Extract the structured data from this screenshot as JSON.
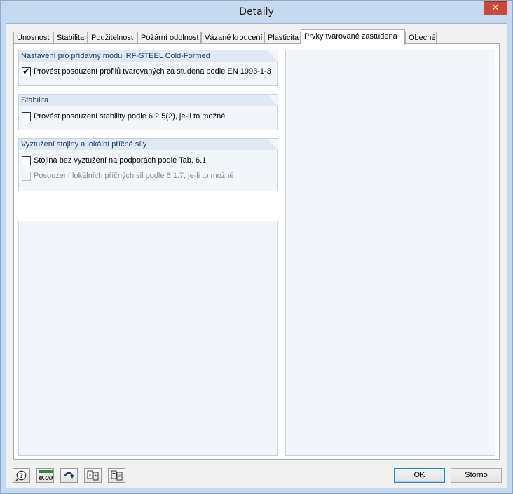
{
  "window": {
    "title": "Detaily",
    "close_glyph": "✕"
  },
  "tabs": [
    {
      "label": "Únosnost",
      "active": false
    },
    {
      "label": "Stabilita",
      "active": false
    },
    {
      "label": "Použitelnost",
      "active": false
    },
    {
      "label": "Požární odolnost",
      "active": false
    },
    {
      "label": "Vázané kroucení",
      "active": false
    },
    {
      "label": "Plasticita",
      "active": false
    },
    {
      "label": "Prvky tvarované zastudena",
      "active": true
    },
    {
      "label": "Obecné",
      "active": false
    }
  ],
  "groups": {
    "cold_formed": {
      "title": "Nastavení pro přídavný modul RF-STEEL Cold-Formed",
      "options": [
        {
          "label": "Provést posouzení profilů tvarovaných za studena podle EN 1993-1-3",
          "checked": true,
          "enabled": true
        }
      ]
    },
    "stability": {
      "title": "Stabilita",
      "options": [
        {
          "label": "Provést posouzení stability podle 6.2.5(2), je-li to možné",
          "checked": false,
          "enabled": true
        }
      ]
    },
    "web": {
      "title": "Vyztužení stojiny a lokální příčné síly",
      "options": [
        {
          "label": "Stojina bez vyztužení na podporách podle Tab. 6.1",
          "checked": false,
          "enabled": true
        },
        {
          "label": "Posouzení lokálních příčných sil podle 6.1.7, je-li to možné",
          "checked": false,
          "enabled": false
        }
      ]
    }
  },
  "toolbar_icons": [
    "help-icon",
    "units-icon",
    "reset-icon",
    "load-icon",
    "save-icon"
  ],
  "units_icon_text": "0.00",
  "buttons": {
    "ok": "OK",
    "cancel": "Storno"
  },
  "colors": {
    "group_header_text": "#1d3b6b",
    "window_frame": "#c5d9f1",
    "close_button": "#c74b3c"
  }
}
